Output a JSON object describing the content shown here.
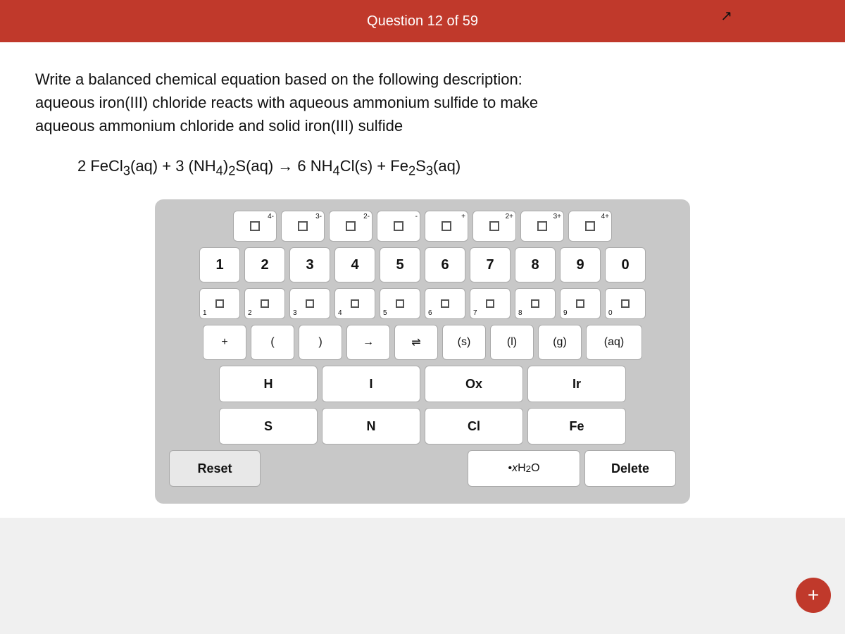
{
  "header": {
    "title": "Question 12 of 59"
  },
  "question": {
    "text": "Write a balanced chemical equation based on the following description:\naqueous iron(III) chloride reacts with aqueous ammonium sulfide to make\naqueous ammonium chloride and solid iron(III) sulfide",
    "equation": "2 FeCl₃(aq) + 3 (NH₄)₂S(aq) → 6 NH₄Cl(s) + Fe₂S₃(aq)"
  },
  "keyboard": {
    "charge_row": [
      {
        "label": "4-",
        "type": "super"
      },
      {
        "label": "3-",
        "type": "super"
      },
      {
        "label": "2-",
        "type": "super"
      },
      {
        "label": "-",
        "type": "super"
      },
      {
        "label": "+",
        "type": "super"
      },
      {
        "label": "2+",
        "type": "super"
      },
      {
        "label": "3+",
        "type": "super"
      },
      {
        "label": "4+",
        "type": "super"
      }
    ],
    "number_row": [
      "1",
      "2",
      "3",
      "4",
      "5",
      "6",
      "7",
      "8",
      "9",
      "0"
    ],
    "sub_number_row": [
      "1",
      "2",
      "3",
      "4",
      "5",
      "6",
      "7",
      "8",
      "9",
      "0"
    ],
    "symbol_row": [
      "+",
      "(",
      ")",
      "→",
      "⇌",
      "(s)",
      "(l)",
      "(g)",
      "(aq)"
    ],
    "element_rows": [
      [
        "H",
        "I",
        "Ox",
        "Ir"
      ],
      [
        "S",
        "N",
        "Cl",
        "Fe"
      ]
    ],
    "bottom_row": {
      "reset": "Reset",
      "water": "• x H₂O",
      "delete": "Delete"
    }
  },
  "plus_button": "+"
}
